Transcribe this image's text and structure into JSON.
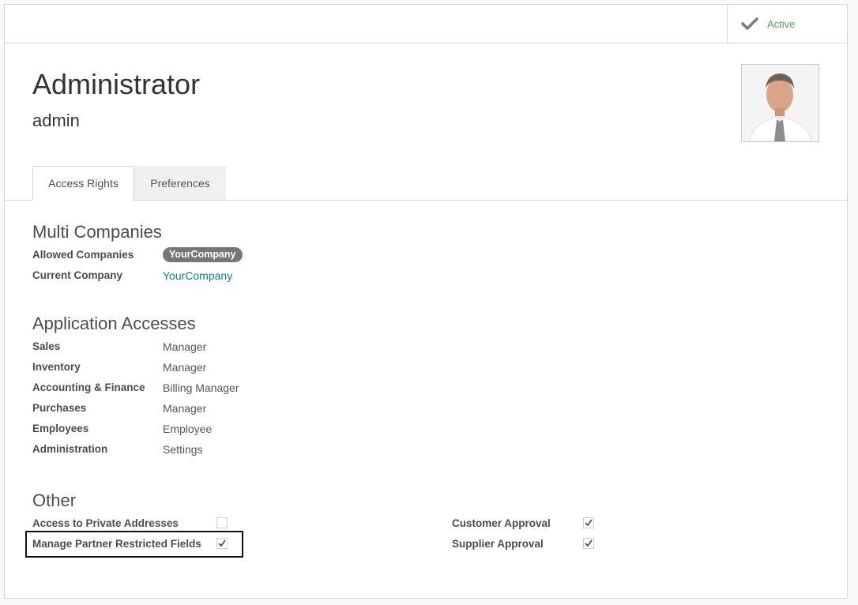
{
  "status": {
    "label": "Active"
  },
  "header": {
    "name": "Administrator",
    "login": "admin"
  },
  "tabs": [
    {
      "label": "Access Rights"
    },
    {
      "label": "Preferences"
    }
  ],
  "multi_companies": {
    "title": "Multi Companies",
    "allowed_label": "Allowed Companies",
    "allowed_tag": "YourCompany",
    "current_label": "Current Company",
    "current_value": "YourCompany"
  },
  "app_accesses": {
    "title": "Application Accesses",
    "rows": [
      {
        "label": "Sales",
        "value": "Manager"
      },
      {
        "label": "Inventory",
        "value": "Manager"
      },
      {
        "label": "Accounting & Finance",
        "value": "Billing Manager"
      },
      {
        "label": "Purchases",
        "value": "Manager"
      },
      {
        "label": "Employees",
        "value": "Employee"
      },
      {
        "label": "Administration",
        "value": "Settings"
      }
    ]
  },
  "other": {
    "title": "Other",
    "private_addresses": {
      "label": "Access to Private Addresses",
      "checked": false
    },
    "partner_restricted": {
      "label": "Manage Partner Restricted Fields",
      "checked": true
    },
    "customer_approval": {
      "label": "Customer Approval",
      "checked": true
    },
    "supplier_approval": {
      "label": "Supplier Approval",
      "checked": true
    }
  },
  "colors": {
    "active_green": "#5a9f5a",
    "link": "#00887a",
    "tag_bg": "#777777"
  }
}
